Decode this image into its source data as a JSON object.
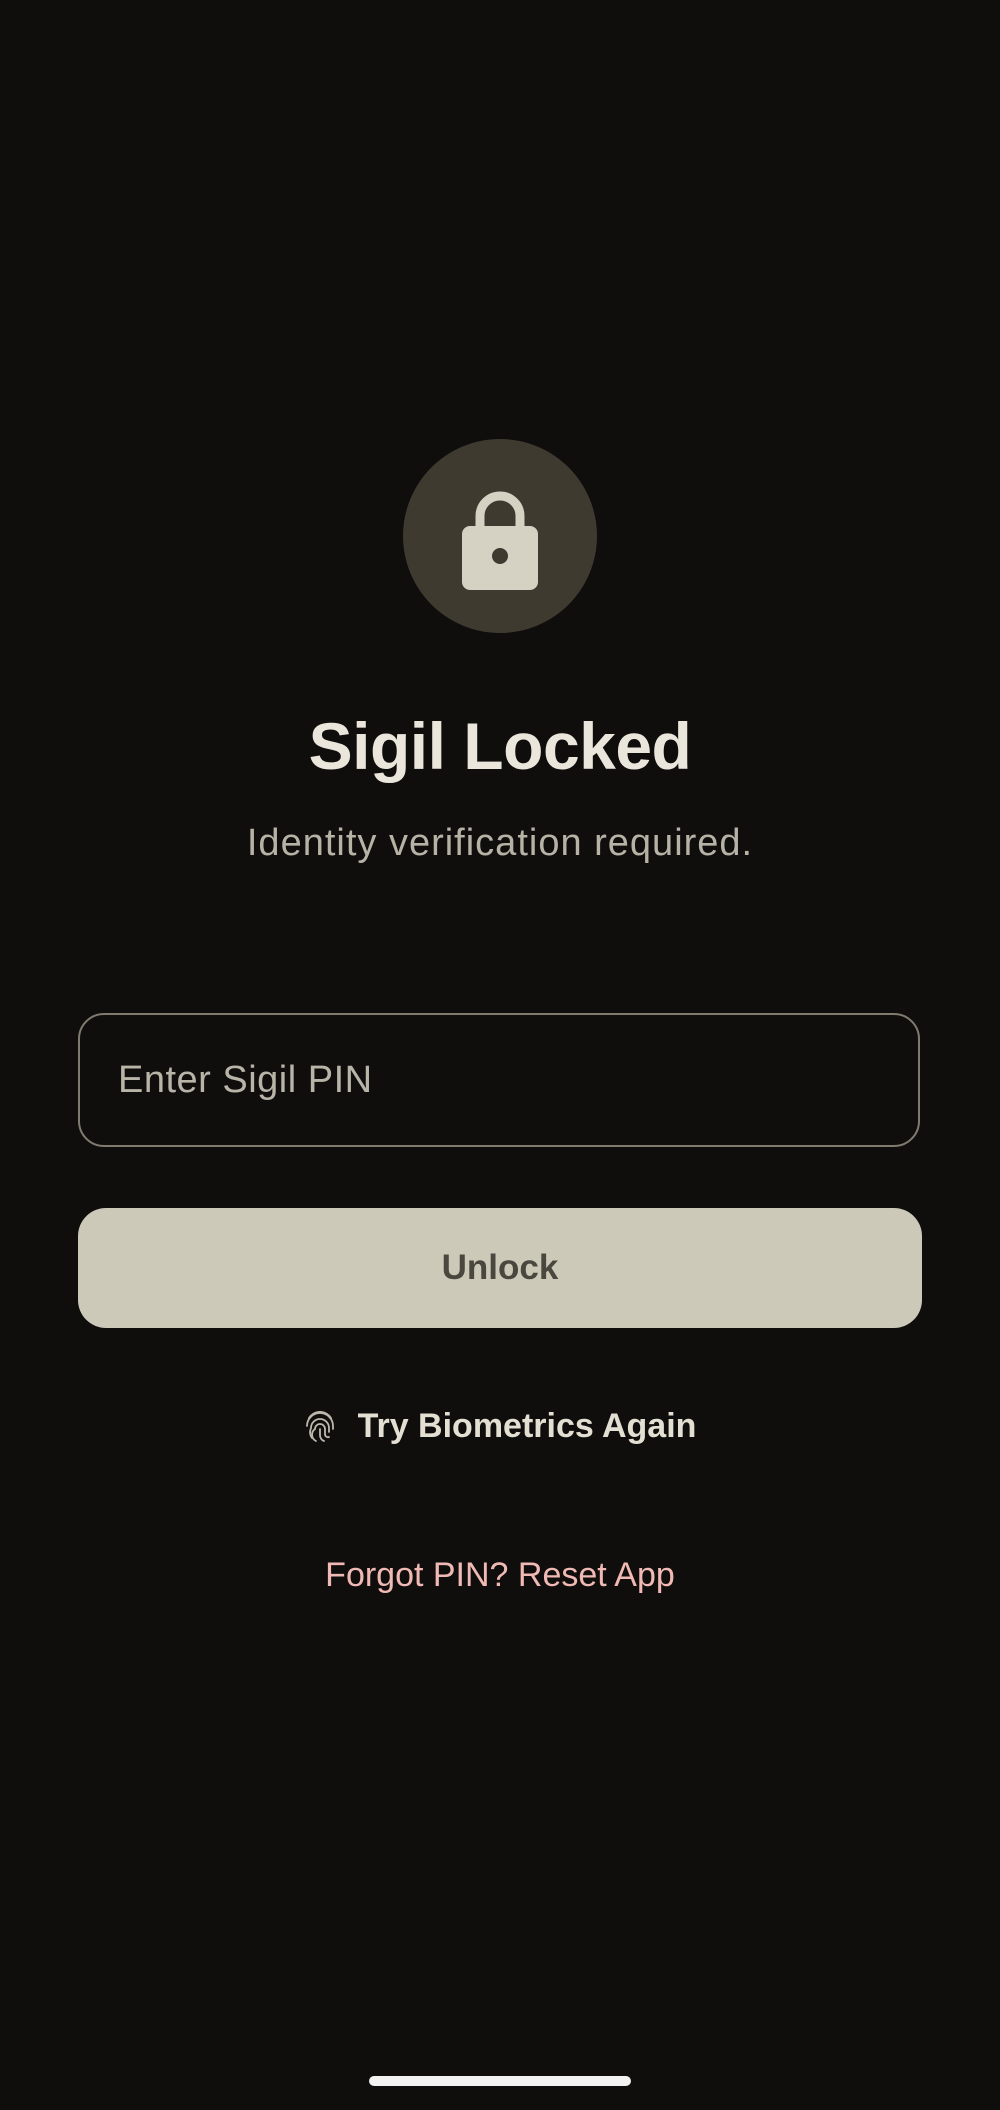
{
  "lock_screen": {
    "title": "Sigil Locked",
    "subtitle": "Identity verification required.",
    "pin_input": {
      "placeholder": "Enter Sigil PIN",
      "value": ""
    },
    "unlock_label": "Unlock",
    "biometrics_label": "Try Biometrics Again",
    "reset_label": "Forgot PIN? Reset App",
    "icons": {
      "header": "lock-icon",
      "biometrics": "fingerprint-icon"
    }
  },
  "colors": {
    "background": "#0f0e0d",
    "lock_circle": "#3e3a2f",
    "primary_button": "#cdc9b9",
    "primary_button_text": "#4a473e",
    "reset_link": "#f0b9b4",
    "text_primary": "#ebe6db",
    "text_secondary": "#b7b2a6"
  }
}
